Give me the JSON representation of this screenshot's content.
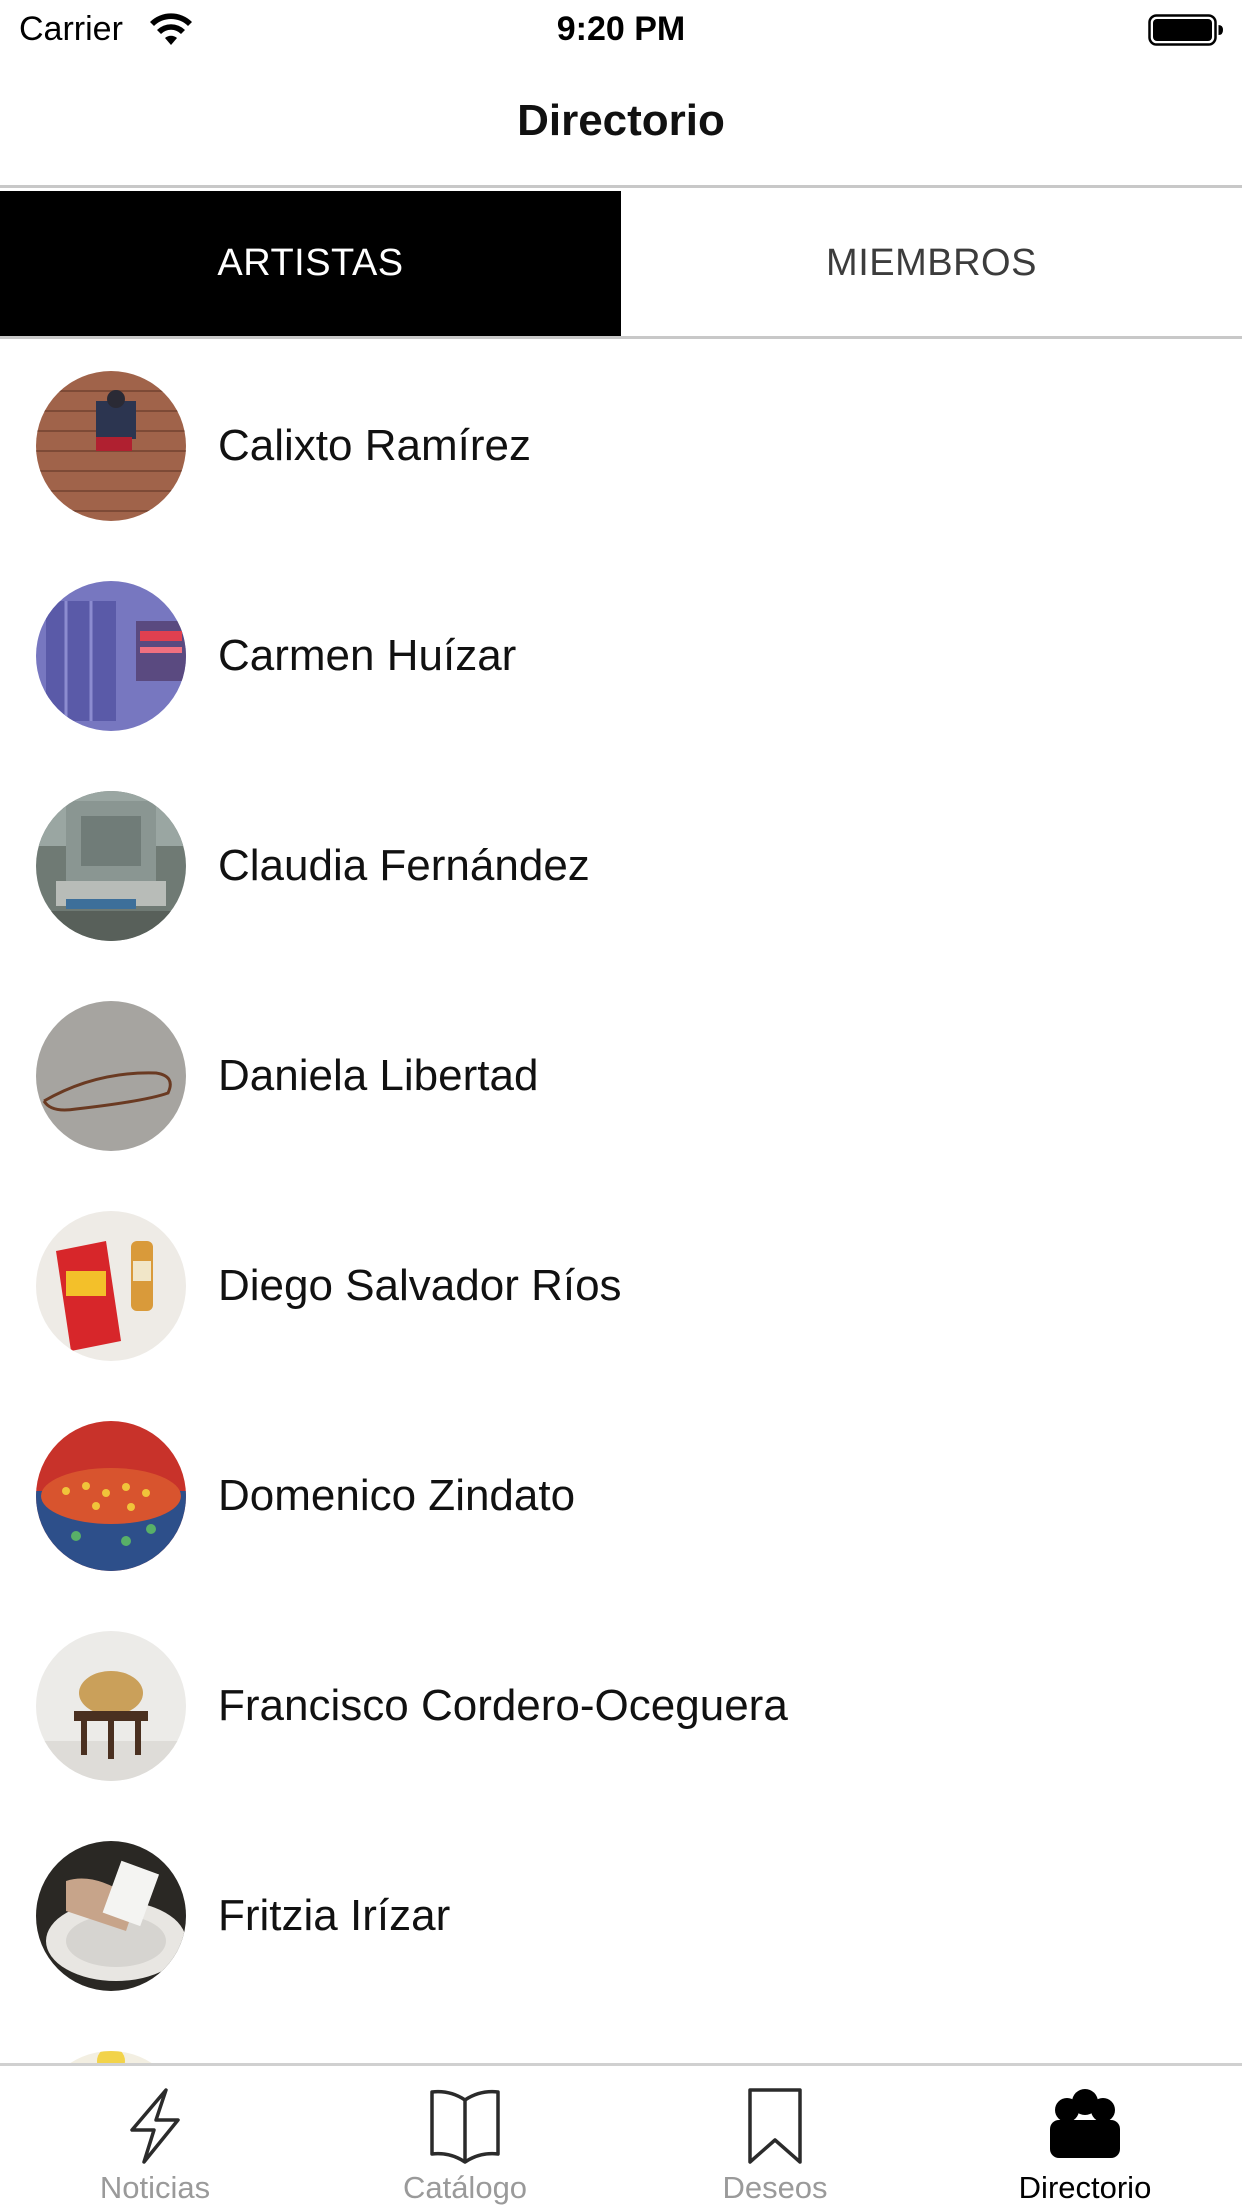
{
  "status_bar": {
    "carrier": "Carrier",
    "time": "9:20 PM"
  },
  "nav": {
    "title": "Directorio"
  },
  "tabs": [
    {
      "label": "ARTISTAS",
      "active": true
    },
    {
      "label": "MIEMBROS",
      "active": false
    }
  ],
  "artists": [
    {
      "name": "Calixto Ramírez",
      "avatar": "brick-wall-climber-photo"
    },
    {
      "name": "Carmen Huízar",
      "avatar": "blue-window-neon-photo"
    },
    {
      "name": "Claudia Fernández",
      "avatar": "stone-monument-person-photo"
    },
    {
      "name": "Daniela Libertad",
      "avatar": "rope-on-concrete-photo"
    },
    {
      "name": "Diego Salvador Ríos",
      "avatar": "chips-bag-bottle-photo"
    },
    {
      "name": "Domenico Zindato",
      "avatar": "red-pattern-painting"
    },
    {
      "name": "Francisco Cordero-Oceguera",
      "avatar": "bread-on-stool-photo"
    },
    {
      "name": "Fritzia Irízar",
      "avatar": "hands-white-plate-photo"
    }
  ],
  "tabbar": [
    {
      "label": "Noticias",
      "icon": "lightning-icon",
      "active": false
    },
    {
      "label": "Catálogo",
      "icon": "open-book-icon",
      "active": false
    },
    {
      "label": "Deseos",
      "icon": "bookmark-icon",
      "active": false
    },
    {
      "label": "Directorio",
      "icon": "people-group-icon",
      "active": true
    }
  ],
  "colors": {
    "active_tab_bg": "#000000",
    "active_tab_text": "#ffffff",
    "inactive_text": "#9a9a9a",
    "divider": "#c8c8c8"
  }
}
